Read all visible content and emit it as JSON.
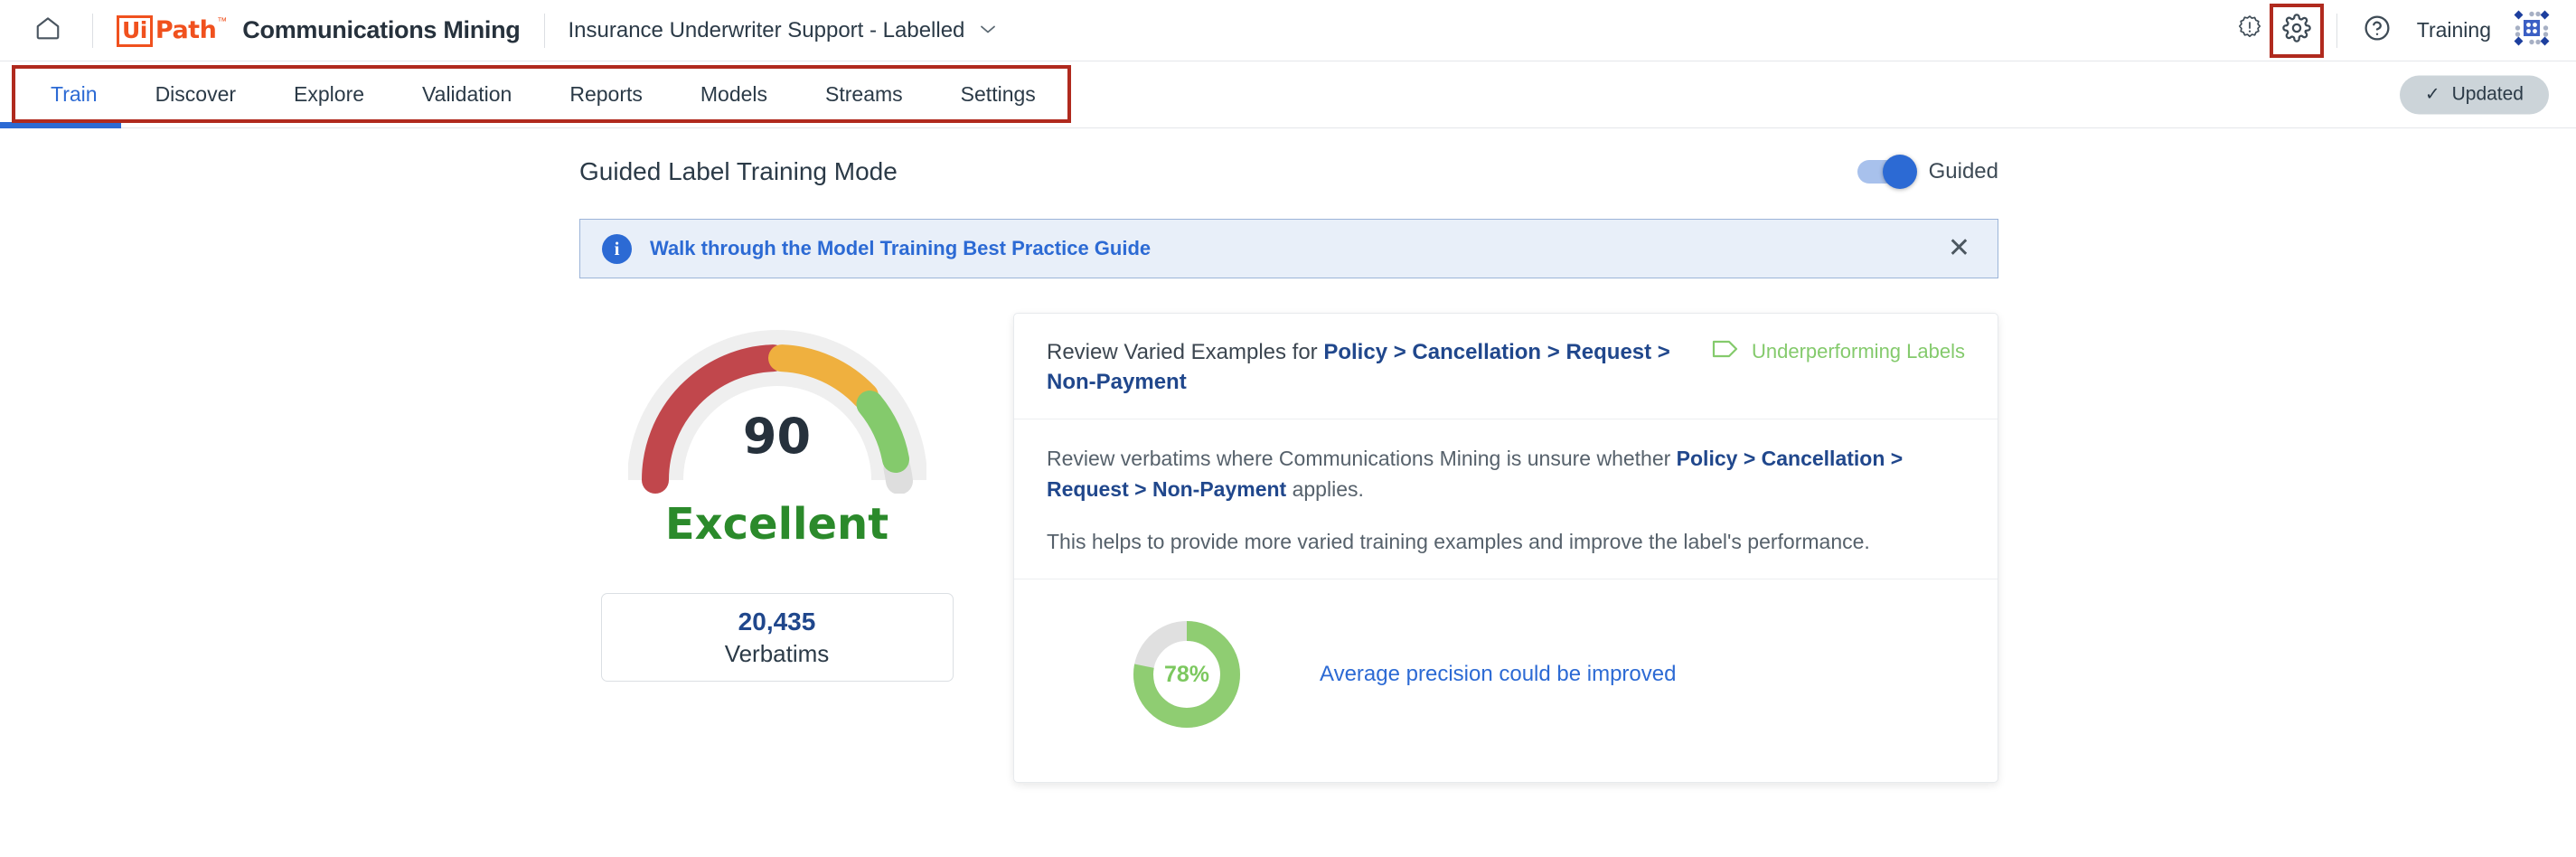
{
  "topbar": {
    "home_icon": "home-icon",
    "logo": {
      "ui": "Ui",
      "path": "Path",
      "tm": "™"
    },
    "product_name": "Communications Mining",
    "project_title": "Insurance Underwriter Support - Labelled",
    "chevron": "⌄",
    "alert_icon": "alert-badge-icon",
    "settings_icon": "gear-icon",
    "help_icon": "help-circle-icon",
    "training_label": "Training",
    "apps_icon": "apps-grid-icon",
    "highlight_color": "#b02a1e"
  },
  "nav": {
    "tabs": [
      {
        "label": "Train",
        "active": true
      },
      {
        "label": "Discover",
        "active": false
      },
      {
        "label": "Explore",
        "active": false
      },
      {
        "label": "Validation",
        "active": false
      },
      {
        "label": "Reports",
        "active": false
      },
      {
        "label": "Models",
        "active": false
      },
      {
        "label": "Streams",
        "active": false
      },
      {
        "label": "Settings",
        "active": false
      }
    ],
    "active_color": "#2c6ad4",
    "status": {
      "label": "Updated",
      "check": "✓"
    }
  },
  "mode": {
    "title": "Guided Label Training Mode",
    "toggle_label": "Guided",
    "toggle_on": true,
    "toggle_color": "#2c6ad4"
  },
  "banner": {
    "icon": "info-icon",
    "icon_glyph": "i",
    "text": "Walk through the Model Training Best Practice Guide",
    "close_glyph": "✕",
    "bg": "#e8eff9",
    "text_color": "#2c6ad4"
  },
  "score": {
    "value": "90",
    "rating": "Excellent",
    "rating_color": "#2b8a2b",
    "verbatims_count": "20,435",
    "verbatims_label": "Verbatims",
    "gauge_colors": {
      "red": "#c1474c",
      "orange": "#efb03f",
      "green": "#84ca6c",
      "track": "#efefef",
      "tail": "#dedede"
    }
  },
  "review": {
    "title_prefix": "Review Varied Examples for ",
    "title_link": "Policy > Cancellation > Request > Non-Payment",
    "tag_icon": "tag-icon",
    "tag_label": "Underperforming Labels",
    "tag_color": "#84ca6c",
    "paragraph1_pre": "Review verbatims where Communications Mining is unsure whether ",
    "paragraph1_link": "Policy > Cancellation > Request > Non-Payment",
    "paragraph1_post": " applies.",
    "paragraph2": "This helps to provide more varied training examples and improve the label's performance."
  },
  "precision": {
    "percent_label": "78%",
    "percent_value": 78,
    "message": "Average precision could be improved",
    "arc_color": "#8fcd72",
    "track_color": "#e0e0e0",
    "message_color": "#2c6ad4"
  }
}
